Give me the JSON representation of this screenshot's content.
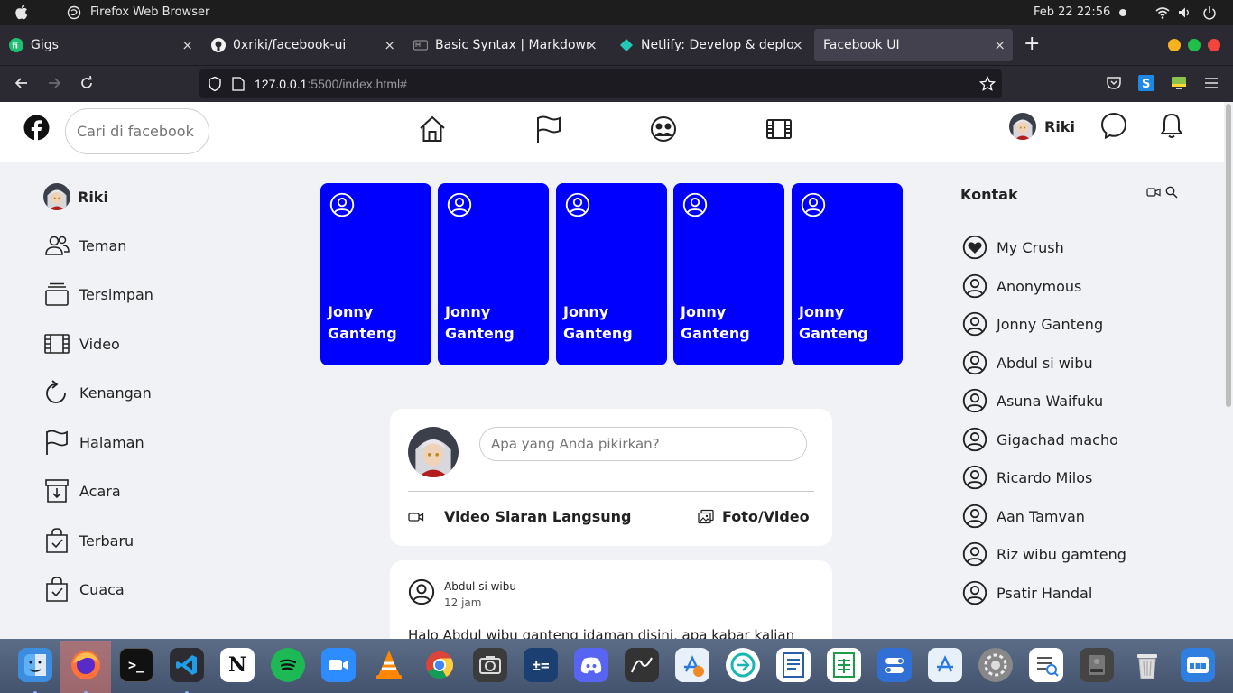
{
  "os_bar": {
    "app_name": "Firefox Web Browser",
    "date": "Feb 22  22:56"
  },
  "browser": {
    "tabs": [
      {
        "title": "Gigs",
        "close": "×"
      },
      {
        "title": "0xriki/facebook-ui",
        "close": "×"
      },
      {
        "title": "Basic Syntax | Markdown",
        "close": "×"
      },
      {
        "title": "Netlify: Develop & deploy",
        "close": "×"
      },
      {
        "title": "Facebook UI",
        "close": "×"
      }
    ],
    "new_tab": "+",
    "url_host": "127.0.0.1",
    "url_rest": ":5500/index.html#"
  },
  "header": {
    "search_placeholder": "Cari di facebook",
    "user_name": "Riki"
  },
  "sidebar": {
    "profile_name": "Riki",
    "items": [
      {
        "label": "Teman",
        "icon": "friends-icon"
      },
      {
        "label": "Tersimpan",
        "icon": "saved-icon"
      },
      {
        "label": "Video",
        "icon": "video-icon"
      },
      {
        "label": "Kenangan",
        "icon": "memories-icon"
      },
      {
        "label": "Halaman",
        "icon": "flag-icon"
      },
      {
        "label": "Acara",
        "icon": "event-icon"
      },
      {
        "label": "Terbaru",
        "icon": "recent-icon"
      },
      {
        "label": "Cuaca",
        "icon": "weather-icon"
      }
    ]
  },
  "stories": [
    {
      "name": "Jonny Ganteng"
    },
    {
      "name": "Jonny Ganteng"
    },
    {
      "name": "Jonny Ganteng"
    },
    {
      "name": "Jonny Ganteng"
    },
    {
      "name": "Jonny Ganteng"
    }
  ],
  "composer": {
    "placeholder": "Apa yang Anda pikirkan?",
    "live_label": "Video Siaran Langsung",
    "photo_label": "Foto/Video"
  },
  "post": {
    "author": "Abdul si wibu",
    "time": "12 jam",
    "text": "Halo Abdul wibu ganteng idaman disini, apa kabar kalian"
  },
  "contacts": {
    "title": "Kontak",
    "items": [
      {
        "name": "My Crush",
        "icon": "heart-icon"
      },
      {
        "name": "Anonymous",
        "icon": "user-circle-icon"
      },
      {
        "name": "Jonny Ganteng",
        "icon": "user-circle-icon"
      },
      {
        "name": "Abdul si wibu",
        "icon": "user-circle-icon"
      },
      {
        "name": "Asuna Waifuku",
        "icon": "user-circle-icon"
      },
      {
        "name": "Gigachad macho",
        "icon": "user-circle-icon"
      },
      {
        "name": "Ricardo Milos",
        "icon": "user-circle-icon"
      },
      {
        "name": "Aan Tamvan",
        "icon": "user-circle-icon"
      },
      {
        "name": "Riz wibu gamteng",
        "icon": "user-circle-icon"
      },
      {
        "name": "Psatir Handal",
        "icon": "user-circle-icon"
      }
    ]
  },
  "colors": {
    "story_blue": "#0000ff",
    "page_bg": "#f0f2f5"
  }
}
